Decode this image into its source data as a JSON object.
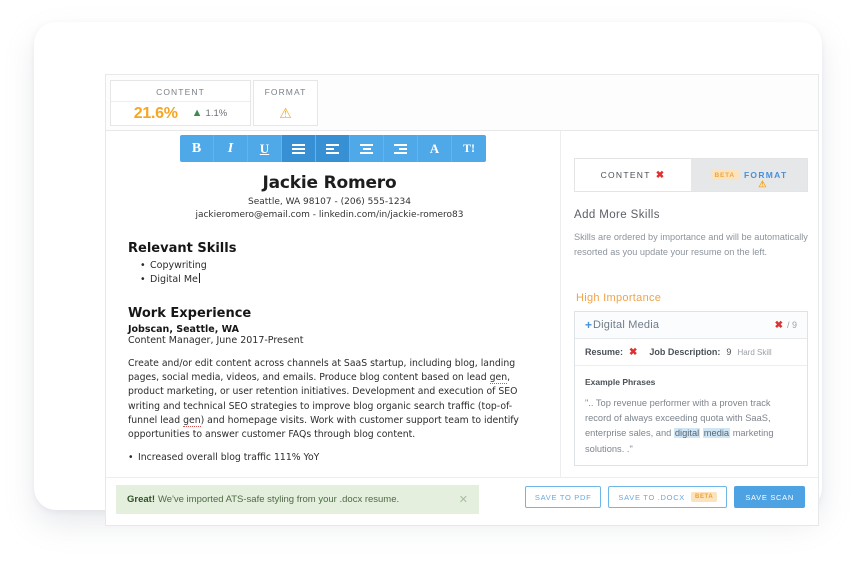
{
  "metrics": {
    "content": {
      "label": "CONTENT",
      "score": "21.6%",
      "delta": "1.1%",
      "arrow": "up-arrow-icon"
    },
    "format": {
      "label": "FORMAT",
      "status_icon": "warning-triangle-icon"
    }
  },
  "toolbar": {
    "buttons": [
      {
        "name": "bold",
        "label": "B"
      },
      {
        "name": "italic",
        "label": "I"
      },
      {
        "name": "underline",
        "label": "U"
      },
      {
        "name": "bullet-list",
        "label": ""
      },
      {
        "name": "align-left",
        "label": ""
      },
      {
        "name": "align-center",
        "label": ""
      },
      {
        "name": "align-right",
        "label": ""
      },
      {
        "name": "font-color",
        "label": "A"
      },
      {
        "name": "clear-format",
        "label": "T!"
      }
    ]
  },
  "resume": {
    "name": "Jackie Romero",
    "contact_line1": "Seattle, WA 98107 - (206) 555-1234",
    "contact_line2": "jackieromero@email.com - linkedin.com/in/jackie-romero83",
    "skills_heading": "Relevant Skills",
    "skills": [
      "Copywriting",
      "Digital Me"
    ],
    "experience_heading": "Work Experience",
    "job_company": "Jobscan, Seattle, WA",
    "job_title_dates": "Content Manager, June 2017-Present",
    "job_paragraph_part1": "Create and/or edit content across channels at SaaS startup, including blog, landing pages, social media, videos, and emails. Produce blog content based on lead ",
    "job_paragraph_spell1": "gen",
    "job_paragraph_part2": ", product marketing, or user retention initiatives. Development and execution of SEO writing and technical SEO strategies to improve blog organic search traffic (top-of-funnel lead ",
    "job_paragraph_spell2": "gen",
    "job_paragraph_part3": ") and homepage visits. Work with customer support team to identify opportunities to answer customer FAQs through blog content.",
    "job_bullet_cut": "Increased overall blog traffic 111% YoY"
  },
  "panel": {
    "tabs": [
      {
        "label": "CONTENT",
        "state": "active",
        "badge_icon": "red-x-icon"
      },
      {
        "label": "FORMAT",
        "state": "inactive",
        "beta": "BETA",
        "warn_icon": "warning-triangle-icon"
      }
    ],
    "title": "Add More Skills",
    "description": "Skills are ordered by importance and will be automatically resorted as you update your resume on the left.",
    "importance_group": "High Importance",
    "skill_card": {
      "expand_icon": "plus-icon",
      "name": "Digital Media",
      "count_x_icon": "red-x-icon",
      "count_total": "/ 9",
      "resume_label": "Resume:",
      "resume_value_icon": "red-x-icon",
      "jd_label": "Job Description:",
      "jd_value": "9",
      "skill_type": "Hard Skill",
      "phrases_title": "Example Phrases",
      "phrase_part1": "\".. Top revenue performer with a proven track record of always exceeding quota with SaaS, enterprise sales, and ",
      "phrase_highlight1": "digital",
      "phrase_part2": " ",
      "phrase_highlight2": "media",
      "phrase_part3": " marketing solutions. .\""
    }
  },
  "bottom": {
    "toast_bold": "Great!",
    "toast_text": "We've imported ATS-safe styling from your .docx resume.",
    "toast_close_icon": "close-icon",
    "save_pdf": "SAVE TO PDF",
    "save_docx": "SAVE TO .DOCX",
    "save_docx_beta": "BETA",
    "save_scan": "SAVE SCAN"
  }
}
